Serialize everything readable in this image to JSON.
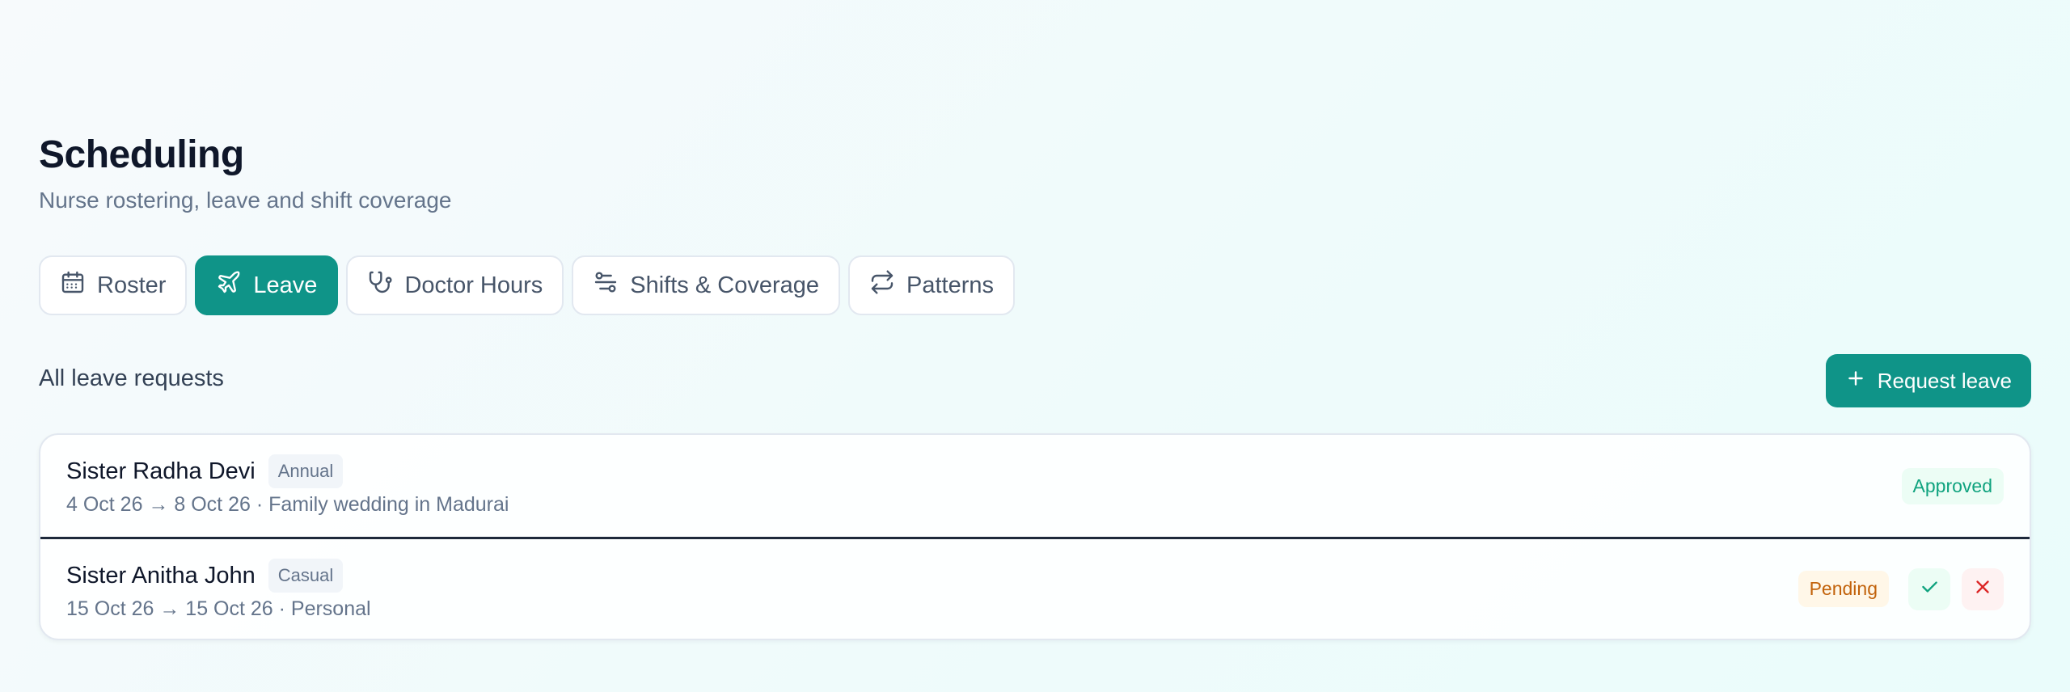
{
  "header": {
    "title": "Scheduling",
    "subtitle": "Nurse rostering, leave and shift coverage"
  },
  "tabs": [
    {
      "label": "Roster",
      "icon": "calendar-icon",
      "active": false
    },
    {
      "label": "Leave",
      "icon": "plane-icon",
      "active": true
    },
    {
      "label": "Doctor Hours",
      "icon": "stethoscope-icon",
      "active": false
    },
    {
      "label": "Shifts & Coverage",
      "icon": "route-icon",
      "active": false
    },
    {
      "label": "Patterns",
      "icon": "repeat-icon",
      "active": false
    }
  ],
  "section": {
    "title": "All leave requests",
    "request_button": "Request leave"
  },
  "requests": [
    {
      "name": "Sister Radha Devi",
      "type": "Annual",
      "detail": "4 Oct 26 → 8 Oct 26 · Family wedding in Madurai",
      "status": "Approved"
    },
    {
      "name": "Sister Anitha John",
      "type": "Casual",
      "detail": "15 Oct 26 → 15 Oct 26 · Personal",
      "status": "Pending"
    }
  ],
  "colors": {
    "accent": "#0f9488",
    "approved_text": "#10a37f",
    "pending_text": "#c2620a",
    "reject": "#dc2626"
  }
}
